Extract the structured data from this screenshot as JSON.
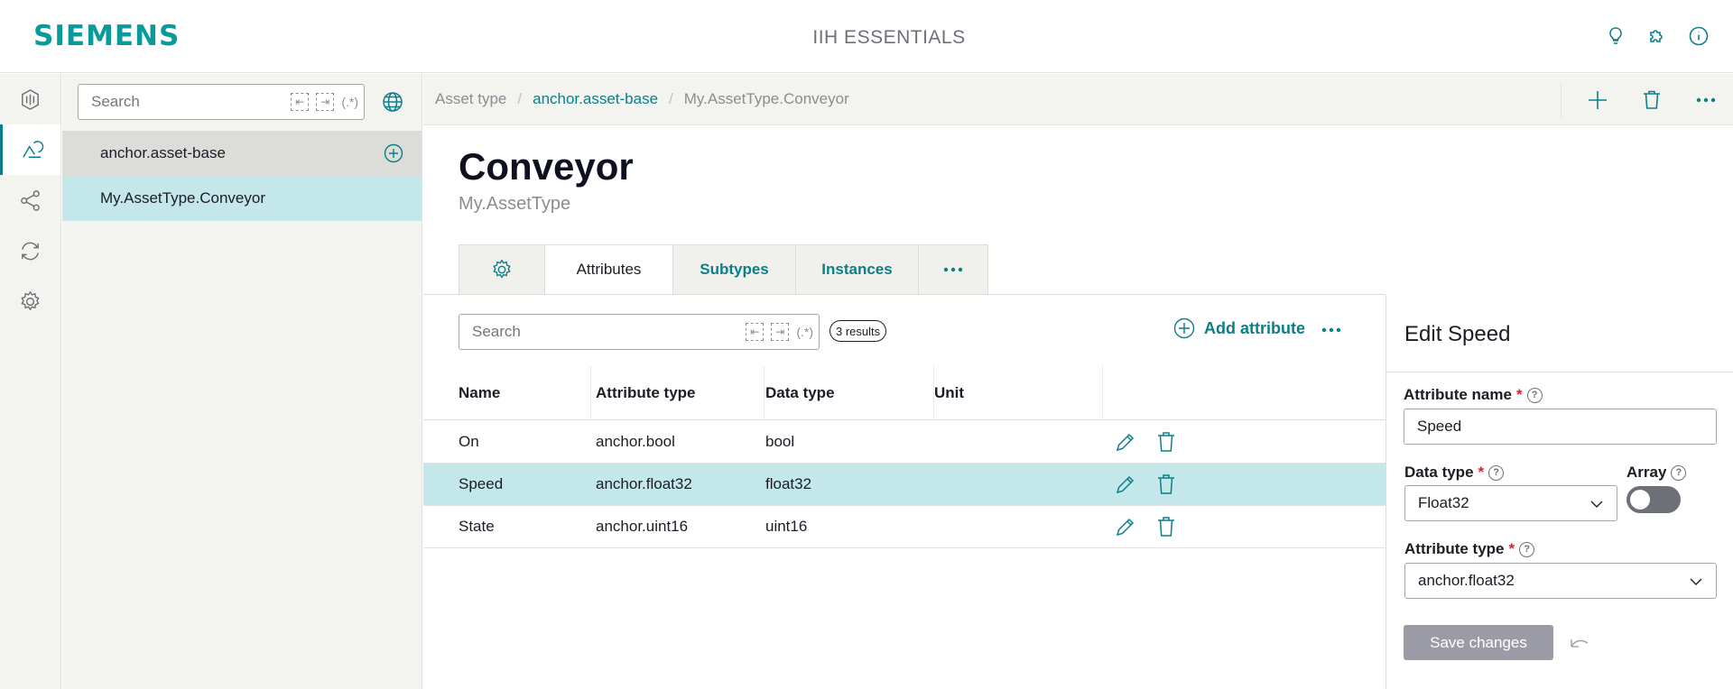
{
  "header": {
    "logo": "SIEMENS",
    "app_title": "IIH ESSENTIALS",
    "icons": [
      "lightbulb-icon",
      "puzzle-icon",
      "info-icon"
    ]
  },
  "rail": {
    "items": [
      "dashboard-icon",
      "asset-model-icon",
      "connections-icon",
      "sync-icon",
      "settings-icon"
    ],
    "active_index": 1
  },
  "tree": {
    "search_placeholder": "Search",
    "items": [
      {
        "label": "anchor.asset-base"
      },
      {
        "label": "My.AssetType.Conveyor"
      }
    ],
    "selected_index": 1
  },
  "breadcrumb": {
    "items": [
      "Asset type",
      "anchor.asset-base",
      "My.AssetType.Conveyor"
    ]
  },
  "main": {
    "title": "Conveyor",
    "subtitle": "My.AssetType",
    "tabs": [
      "Attributes",
      "Subtypes",
      "Instances"
    ],
    "active_tab": "Attributes",
    "search_placeholder": "Search",
    "results": "3 results",
    "add_attribute": "Add attribute",
    "columns": [
      "Name",
      "Attribute type",
      "Data type",
      "Unit"
    ],
    "rows": [
      {
        "name": "On",
        "attribute_type": "anchor.bool",
        "data_type": "bool",
        "unit": ""
      },
      {
        "name": "Speed",
        "attribute_type": "anchor.float32",
        "data_type": "float32",
        "unit": ""
      },
      {
        "name": "State",
        "attribute_type": "anchor.uint16",
        "data_type": "uint16",
        "unit": ""
      }
    ],
    "selected_row": 1
  },
  "edit": {
    "title": "Edit Speed",
    "attribute_name_label": "Attribute name",
    "attribute_name_value": "Speed",
    "data_type_label": "Data type",
    "data_type_value": "Float32",
    "array_label": "Array",
    "array_enabled": false,
    "attribute_type_label": "Attribute type",
    "attribute_type_value": "anchor.float32",
    "save_label": "Save changes",
    "required_mark": "*",
    "help_mark": "?"
  },
  "colors": {
    "brand": "#0a9a9b",
    "accent": "#0a7f8a",
    "selected_row": "#c4e7ea",
    "required": "#d72339"
  }
}
